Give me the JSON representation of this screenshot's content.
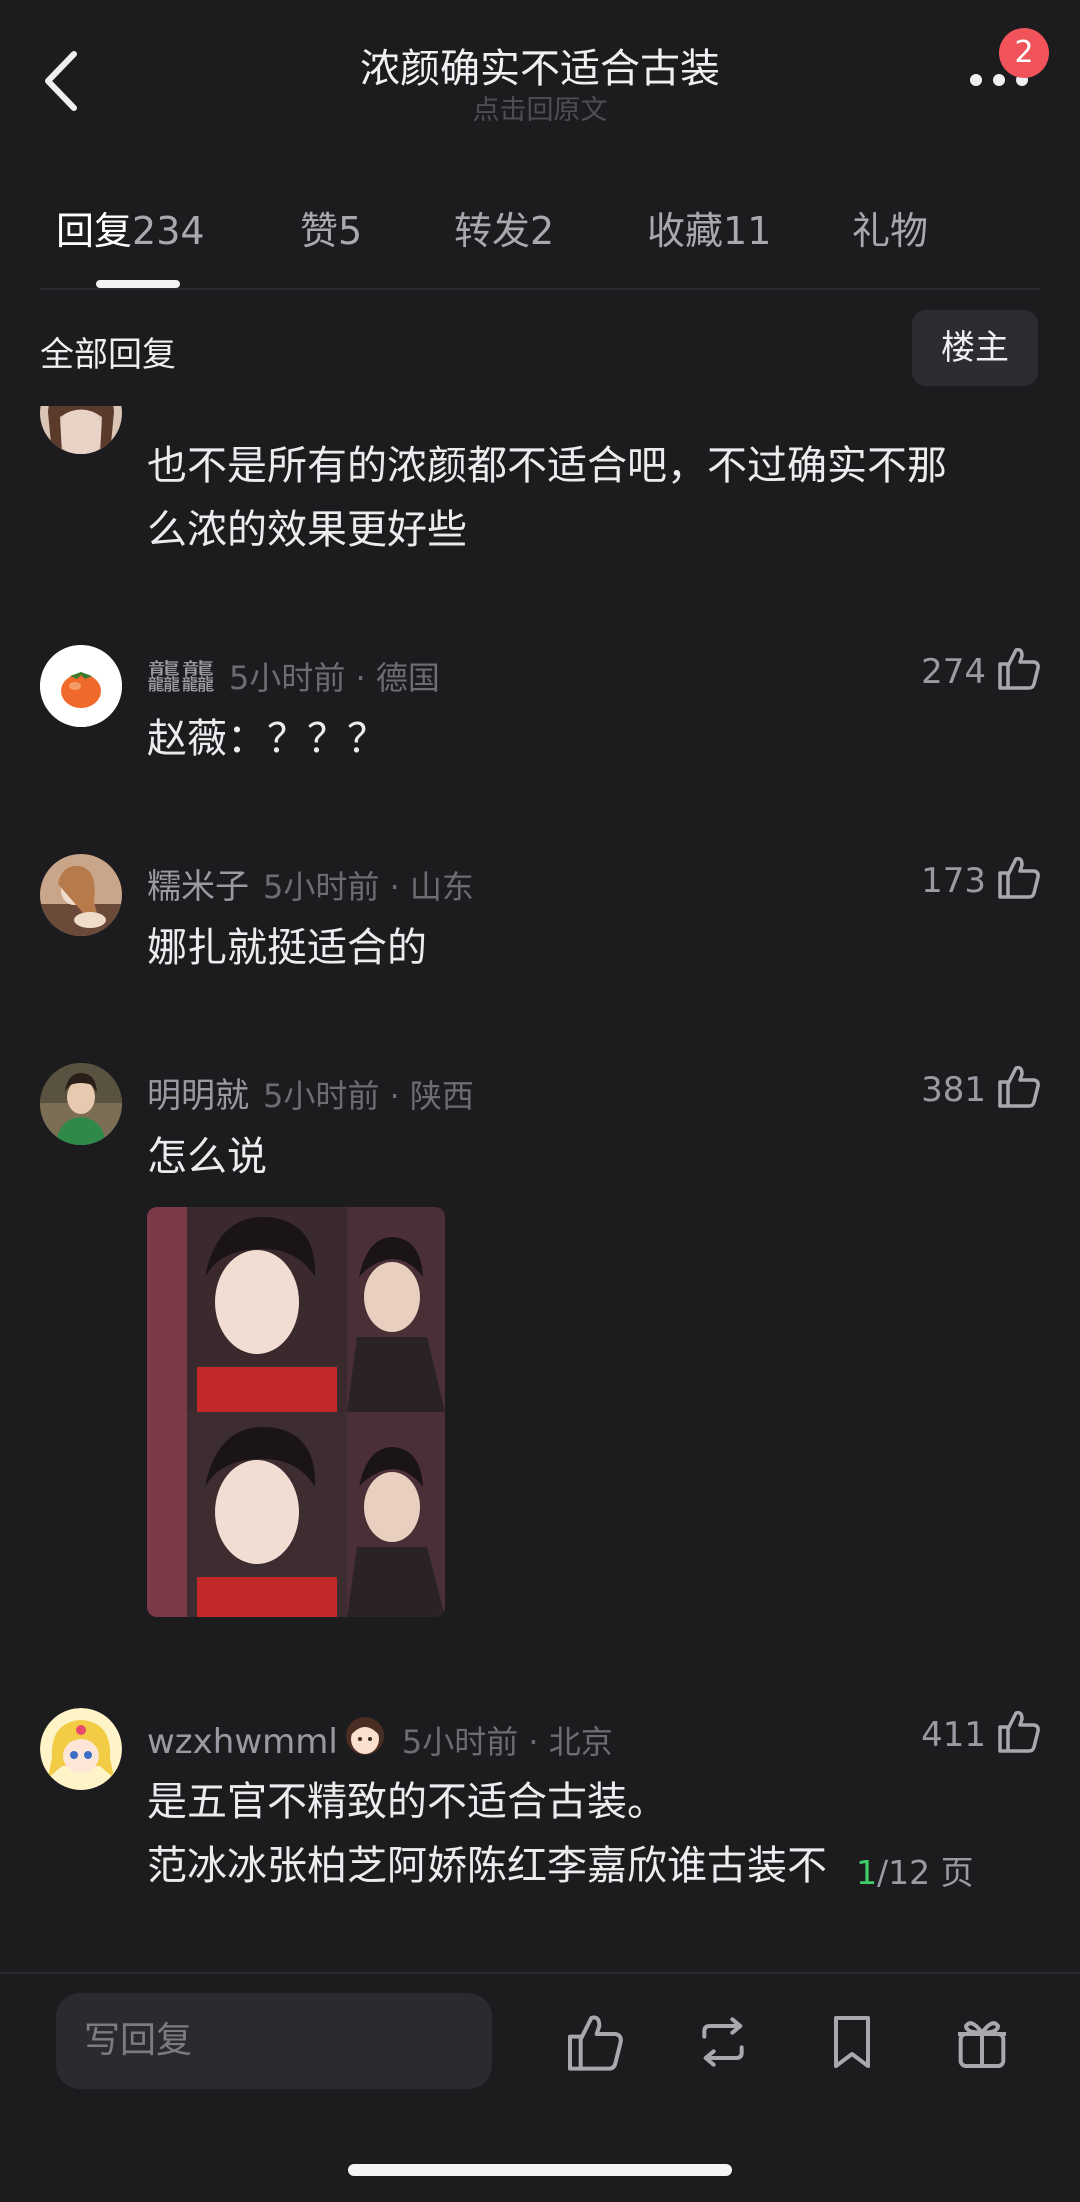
{
  "header": {
    "title": "浓颜确实不适合古装",
    "subtitle": "点击回原文",
    "badge_count": "2"
  },
  "tabs": [
    {
      "label": "回复",
      "count": "234",
      "active": true
    },
    {
      "label": "赞",
      "count": "5"
    },
    {
      "label": "转发",
      "count": "2"
    },
    {
      "label": "收藏",
      "count": "11"
    },
    {
      "label": "礼物",
      "count": ""
    }
  ],
  "filter": {
    "all_replies": "全部回复",
    "louzhu": "楼主"
  },
  "comments": [
    {
      "text_lines": [
        "也不是所有的浓颜都不适合吧，不过确实不那",
        "么浓的效果更好些"
      ]
    },
    {
      "username": "龘龘",
      "time_location": "5小时前 · 德国",
      "likes": "274",
      "text_lines": [
        "赵薇：？？？"
      ]
    },
    {
      "username": "糯米子",
      "time_location": "5小时前 · 山东",
      "likes": "173",
      "text_lines": [
        "娜扎就挺适合的"
      ]
    },
    {
      "username": "明明就",
      "time_location": "5小时前 · 陕西",
      "likes": "381",
      "text_lines": [
        "怎么说"
      ]
    },
    {
      "username": "wzxhwmml",
      "time_location": "5小时前 · 北京",
      "likes": "411",
      "text_lines": [
        "是五官不精致的不适合古装。",
        "范冰冰张柏芝阿娇陈红李嘉欣谁古装不"
      ]
    }
  ],
  "pagination": {
    "current": "1",
    "rest": "/12 页"
  },
  "bottom_bar": {
    "reply_placeholder": "写回复"
  },
  "colors": {
    "background": "#1c1c1f",
    "badge": "#f0545a",
    "page_current": "#3fcf6a"
  }
}
